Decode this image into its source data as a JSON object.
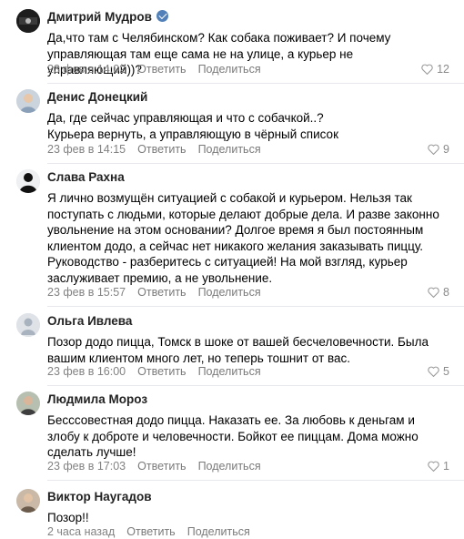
{
  "colors": {
    "accent": "#5181b8",
    "meta": "#828282",
    "divider": "#e7e8ec"
  },
  "actions": {
    "reply": "Ответить",
    "share": "Поделиться"
  },
  "comments": [
    {
      "author": "Дмитрий Мудров",
      "avatar_icon": "dog-logo-avatar",
      "verified": true,
      "text": "Да,что там с Челябинском? Как собака поживает? И почему управляющая там еще сама не на улице, а курьер не управляющий))?",
      "time": "23 фев в 14:02",
      "likes": "12"
    },
    {
      "author": "Денис Донецкий",
      "avatar_icon": "photo-avatar",
      "verified": false,
      "text": "Да, где сейчас управляющая и что с собачкой..?\nКурьера вернуть, а управляющую в чёрный список",
      "time": "23 фев в 14:15",
      "likes": "9"
    },
    {
      "author": "Слава Рахна",
      "avatar_icon": "person-silhouette-avatar",
      "verified": false,
      "text": "Я лично возмущён ситуацией с собакой и курьером. Нельзя так поступать с людьми, которые делают добрые дела. И разве законно увольнение на этом основании? Долгое время я был постоянным клиентом додо, а сейчас нет никакого желания заказывать пиццу. Руководство - разберитесь с ситуацией! На мой взгляд, курьер заслуживает премию, а не увольнение.",
      "time": "23 фев в 15:57",
      "likes": "8"
    },
    {
      "author": "Ольга Ивлева",
      "avatar_icon": "default-user-avatar",
      "verified": false,
      "text": "Позор додо пицца, Томск в шоке от вашей бесчеловечности. Была вашим клиентом много лет, но теперь тошнит от вас.",
      "time": "23 фев в 16:00",
      "likes": "5"
    },
    {
      "author": "Людмила Мороз",
      "avatar_icon": "photo-avatar",
      "verified": false,
      "text": "Бесссовестная додо пицца. Наказать ее. За любовь к деньгам и злобу к доброте и человечности. Бойкот ее пиццам. Дома можно сделать лучше!",
      "time": "23 фев в 17:03",
      "likes": "1"
    },
    {
      "author": "Виктор Наугадов",
      "avatar_icon": "photo-avatar",
      "verified": false,
      "text": "Позор!!",
      "time": "2 часа назад",
      "likes": ""
    }
  ]
}
